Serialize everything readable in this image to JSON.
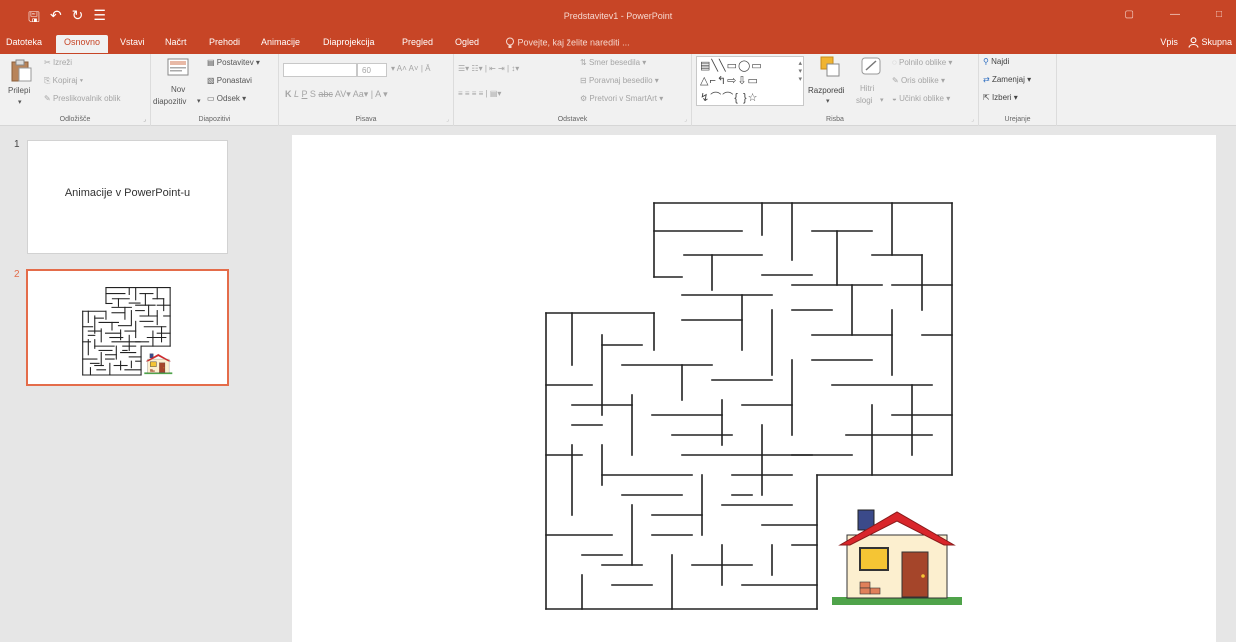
{
  "window": {
    "title": "Predstavitev1 - PowerPoint",
    "controls": [
      "▢",
      "—",
      "□"
    ]
  },
  "qat": [
    "🖫",
    "↶",
    "↻",
    "☰"
  ],
  "tabs": [
    "Datoteka",
    "Osnovno",
    "Vstavi",
    "Načrt",
    "Prehodi",
    "Animacije",
    "Diaprojekcija",
    "Pregled",
    "Ogled"
  ],
  "active_tab": "Osnovno",
  "tell_me": "Povejte, kaj želite narediti ...",
  "account": {
    "signin": "Vpis",
    "share": "Skupna"
  },
  "ribbon": {
    "clipboard": {
      "label": "Odložišče",
      "paste": "Prilepi",
      "cut": "Izreži",
      "copy": "Kopiraj",
      "format_painter": "Preslikovalnik oblik"
    },
    "slides": {
      "label": "Diapozitivi",
      "new_line1": "Nov",
      "new_line2": "diapozitiv",
      "layout": "Postavitev",
      "reset": "Ponastavi",
      "section": "Odsek"
    },
    "font": {
      "label": "Pisava",
      "size": "60"
    },
    "paragraph": {
      "label": "Odstavek",
      "text_dir": "Smer besedila",
      "align_text": "Poravnaj besedilo",
      "smartart": "Pretvori v SmartArt"
    },
    "drawing": {
      "label": "Risba",
      "arrange": "Razporedi",
      "quick_line1": "Hitri",
      "quick_line2": "slogi",
      "fill": "Polnilo oblike",
      "outline": "Oris oblike",
      "effects": "Učinki oblike"
    },
    "editing": {
      "label": "Urejanje",
      "find": "Najdi",
      "replace": "Zamenjaj",
      "select": "Izberi"
    }
  },
  "slides": [
    {
      "number": "1",
      "title": "Animacije v PowerPoint-u"
    },
    {
      "number": "2"
    }
  ],
  "colors": {
    "accent": "#c74526",
    "thumb_selected": "#e46c4a",
    "house_roof": "#d9262b",
    "house_wall": "#fcefcf",
    "house_door": "#a5452a",
    "house_window": "#f5c534",
    "grass": "#4fa34a"
  }
}
